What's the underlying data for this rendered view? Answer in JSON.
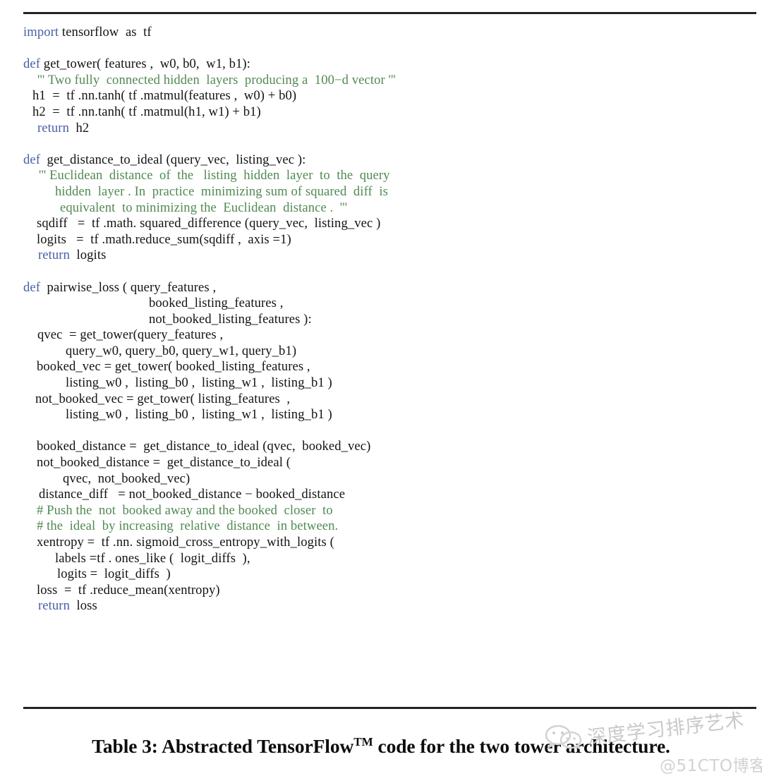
{
  "figure": {
    "caption_prefix": "Table 3: Abstracted TensorFlow",
    "caption_superscript": "TM",
    "caption_suffix": " code for the two tower architecture.",
    "rule_color": "#242424",
    "background_color": "#ffffff"
  },
  "syntax_colors": {
    "keyword": "#4a5fa5",
    "comment": "#508a52",
    "text": "#131313"
  },
  "code": {
    "language": "python",
    "lines": [
      {
        "indent": 0,
        "tokens": [
          {
            "t": "kw",
            "s": "import"
          },
          {
            "t": "txt",
            "s": " tensorflow  as  tf"
          }
        ]
      },
      {
        "indent": 0,
        "tokens": []
      },
      {
        "indent": 0,
        "tokens": [
          {
            "t": "kw",
            "s": "def"
          },
          {
            "t": "txt",
            "s": " get_tower( features ,  w0, b0,  w1, b1):"
          }
        ]
      },
      {
        "indent": 20,
        "tokens": [
          {
            "t": "cmt",
            "s": "''' Two fully  connected hidden  layers  producing a  100−d vector '''"
          }
        ]
      },
      {
        "indent": 13,
        "tokens": [
          {
            "t": "txt",
            "s": "h1  =  tf .nn.tanh( tf .matmul(features ,  w0) + b0)"
          }
        ]
      },
      {
        "indent": 13,
        "tokens": [
          {
            "t": "txt",
            "s": "h2  =  tf .nn.tanh( tf .matmul(h1, w1) + b1)"
          }
        ]
      },
      {
        "indent": 20,
        "tokens": [
          {
            "t": "kw",
            "s": "return"
          },
          {
            "t": "txt",
            "s": "  h2"
          }
        ]
      },
      {
        "indent": 0,
        "tokens": []
      },
      {
        "indent": 0,
        "tokens": [
          {
            "t": "kw",
            "s": "def"
          },
          {
            "t": "txt",
            "s": "  get_distance_to_ideal (query_vec,  listing_vec ):"
          }
        ]
      },
      {
        "indent": 22,
        "tokens": [
          {
            "t": "cmt",
            "s": "''' Euclidean  distance  of  the   listing  hidden  layer  to  the  query"
          }
        ]
      },
      {
        "indent": 45,
        "tokens": [
          {
            "t": "cmt",
            "s": "hidden  layer . In  practice  minimizing sum of squared  diff  is"
          }
        ]
      },
      {
        "indent": 52,
        "tokens": [
          {
            "t": "cmt",
            "s": "equivalent  to minimizing the  Euclidean  distance .  '''"
          }
        ]
      },
      {
        "indent": 19,
        "tokens": [
          {
            "t": "txt",
            "s": "sqdiff   =  tf .math. squared_difference (query_vec,  listing_vec )"
          }
        ]
      },
      {
        "indent": 19,
        "tokens": [
          {
            "t": "txt",
            "s": "logits   =  tf .math.reduce_sum(sqdiff ,  axis =1)"
          }
        ]
      },
      {
        "indent": 21,
        "tokens": [
          {
            "t": "kw",
            "s": "return"
          },
          {
            "t": "txt",
            "s": "  logits"
          }
        ]
      },
      {
        "indent": 0,
        "tokens": []
      },
      {
        "indent": 0,
        "tokens": [
          {
            "t": "kw",
            "s": "def"
          },
          {
            "t": "txt",
            "s": "  pairwise_loss ( query_features ,"
          }
        ]
      },
      {
        "indent": 178,
        "tokens": [
          {
            "t": "txt",
            "s": "booked_listing_features ,"
          }
        ]
      },
      {
        "indent": 178,
        "tokens": [
          {
            "t": "txt",
            "s": "not_booked_listing_features ):"
          }
        ]
      },
      {
        "indent": 20,
        "tokens": [
          {
            "t": "txt",
            "s": "qvec  = get_tower(query_features ,"
          }
        ]
      },
      {
        "indent": 60,
        "tokens": [
          {
            "t": "txt",
            "s": "query_w0, query_b0, query_w1, query_b1)"
          }
        ]
      },
      {
        "indent": 19,
        "tokens": [
          {
            "t": "txt",
            "s": "booked_vec = get_tower( booked_listing_features ,"
          }
        ]
      },
      {
        "indent": 60,
        "tokens": [
          {
            "t": "txt",
            "s": "listing_w0 ,  listing_b0 ,  listing_w1 ,  listing_b1 )"
          }
        ]
      },
      {
        "indent": 17,
        "tokens": [
          {
            "t": "txt",
            "s": "not_booked_vec = get_tower( listing_features  ,"
          }
        ]
      },
      {
        "indent": 60,
        "tokens": [
          {
            "t": "txt",
            "s": "listing_w0 ,  listing_b0 ,  listing_w1 ,  listing_b1 )"
          }
        ]
      },
      {
        "indent": 0,
        "tokens": []
      },
      {
        "indent": 19,
        "tokens": [
          {
            "t": "txt",
            "s": "booked_distance =  get_distance_to_ideal (qvec,  booked_vec)"
          }
        ]
      },
      {
        "indent": 19,
        "tokens": [
          {
            "t": "txt",
            "s": "not_booked_distance =  get_distance_to_ideal ("
          }
        ]
      },
      {
        "indent": 56,
        "tokens": [
          {
            "t": "txt",
            "s": "qvec,  not_booked_vec)"
          }
        ]
      },
      {
        "indent": 22,
        "tokens": [
          {
            "t": "txt",
            "s": "distance_diff   = not_booked_distance − booked_distance"
          }
        ]
      },
      {
        "indent": 19,
        "tokens": [
          {
            "t": "cmt",
            "s": "# Push the  not  booked away and the booked  closer  to"
          }
        ]
      },
      {
        "indent": 19,
        "tokens": [
          {
            "t": "cmt",
            "s": "# the  ideal  by increasing  relative  distance  in between."
          }
        ]
      },
      {
        "indent": 19,
        "tokens": [
          {
            "t": "txt",
            "s": "xentropy =  tf .nn. sigmoid_cross_entropy_with_logits ("
          }
        ]
      },
      {
        "indent": 45,
        "tokens": [
          {
            "t": "txt",
            "s": "labels =tf . ones_like (  logit_diffs  ),"
          }
        ]
      },
      {
        "indent": 48,
        "tokens": [
          {
            "t": "txt",
            "s": "logits =  logit_diffs  )"
          }
        ]
      },
      {
        "indent": 19,
        "tokens": [
          {
            "t": "txt",
            "s": "loss  =  tf .reduce_mean(xentropy)"
          }
        ]
      },
      {
        "indent": 21,
        "tokens": [
          {
            "t": "kw",
            "s": "return"
          },
          {
            "t": "txt",
            "s": "  loss"
          }
        ]
      }
    ]
  },
  "watermark": {
    "logo": "wechat-logo",
    "chinese_text": "深度学习排序艺术",
    "site_text": "@51CTO博客",
    "color": "#cccccc"
  }
}
